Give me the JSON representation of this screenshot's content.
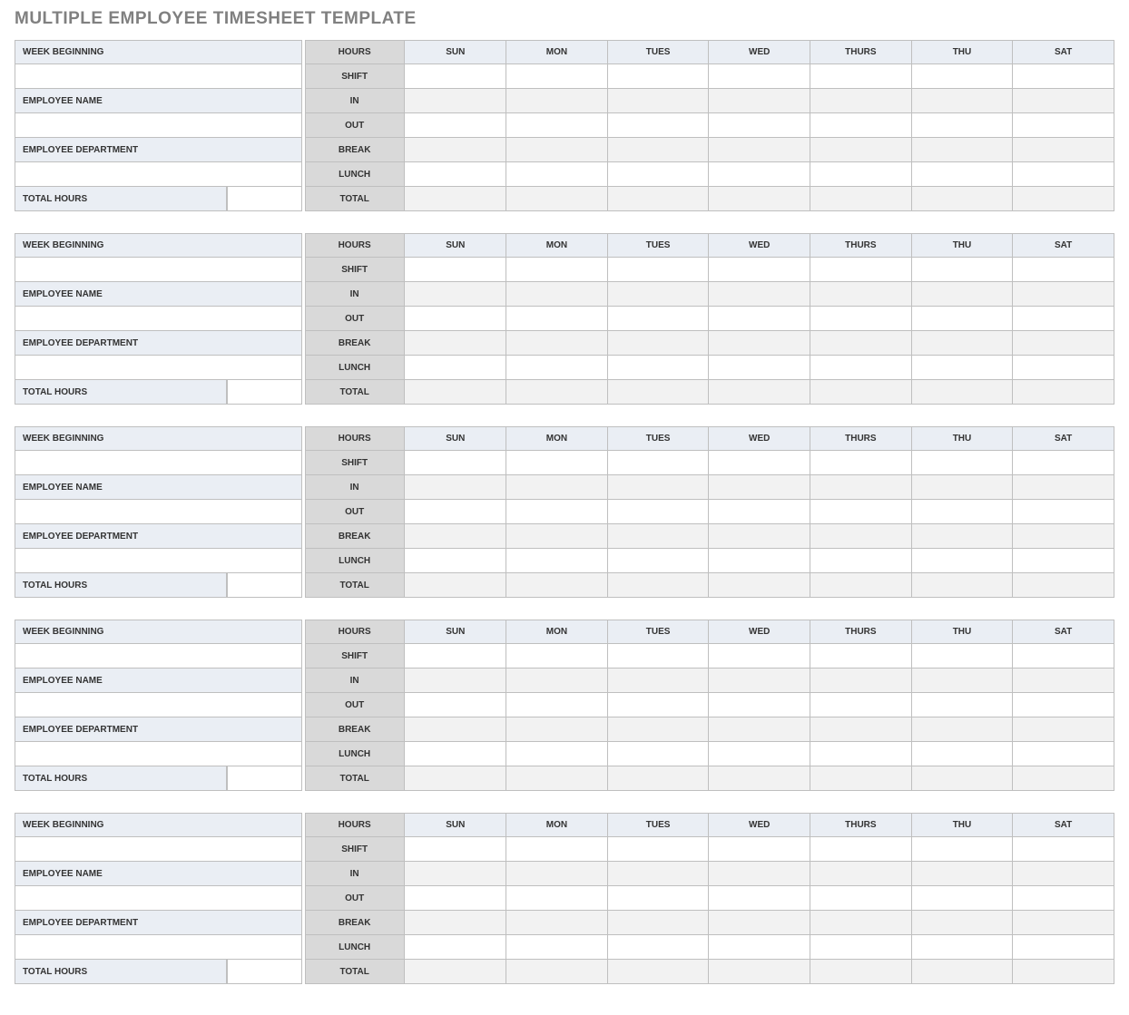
{
  "title": "MULTIPLE EMPLOYEE TIMESHEET TEMPLATE",
  "left_labels": {
    "week_beginning": "WEEK BEGINNING",
    "employee_name": "EMPLOYEE NAME",
    "employee_department": "EMPLOYEE DEPARTMENT",
    "total_hours": "TOTAL HOURS"
  },
  "hours_column": {
    "header": "HOURS",
    "rows": [
      "SHIFT",
      "IN",
      "OUT",
      "BREAK",
      "LUNCH",
      "TOTAL"
    ]
  },
  "days": [
    "SUN",
    "MON",
    "TUES",
    "WED",
    "THURS",
    "THU",
    "SAT"
  ],
  "blocks": [
    {
      "week_beginning": "",
      "employee_name": "",
      "employee_department": "",
      "total_hours": "",
      "cells": {
        "shift": [
          "",
          "",
          "",
          "",
          "",
          "",
          ""
        ],
        "in": [
          "",
          "",
          "",
          "",
          "",
          "",
          ""
        ],
        "out": [
          "",
          "",
          "",
          "",
          "",
          "",
          ""
        ],
        "break": [
          "",
          "",
          "",
          "",
          "",
          "",
          ""
        ],
        "lunch": [
          "",
          "",
          "",
          "",
          "",
          "",
          ""
        ],
        "total": [
          "",
          "",
          "",
          "",
          "",
          "",
          ""
        ]
      }
    },
    {
      "week_beginning": "",
      "employee_name": "",
      "employee_department": "",
      "total_hours": "",
      "cells": {
        "shift": [
          "",
          "",
          "",
          "",
          "",
          "",
          ""
        ],
        "in": [
          "",
          "",
          "",
          "",
          "",
          "",
          ""
        ],
        "out": [
          "",
          "",
          "",
          "",
          "",
          "",
          ""
        ],
        "break": [
          "",
          "",
          "",
          "",
          "",
          "",
          ""
        ],
        "lunch": [
          "",
          "",
          "",
          "",
          "",
          "",
          ""
        ],
        "total": [
          "",
          "",
          "",
          "",
          "",
          "",
          ""
        ]
      }
    },
    {
      "week_beginning": "",
      "employee_name": "",
      "employee_department": "",
      "total_hours": "",
      "cells": {
        "shift": [
          "",
          "",
          "",
          "",
          "",
          "",
          ""
        ],
        "in": [
          "",
          "",
          "",
          "",
          "",
          "",
          ""
        ],
        "out": [
          "",
          "",
          "",
          "",
          "",
          "",
          ""
        ],
        "break": [
          "",
          "",
          "",
          "",
          "",
          "",
          ""
        ],
        "lunch": [
          "",
          "",
          "",
          "",
          "",
          "",
          ""
        ],
        "total": [
          "",
          "",
          "",
          "",
          "",
          "",
          ""
        ]
      }
    },
    {
      "week_beginning": "",
      "employee_name": "",
      "employee_department": "",
      "total_hours": "",
      "cells": {
        "shift": [
          "",
          "",
          "",
          "",
          "",
          "",
          ""
        ],
        "in": [
          "",
          "",
          "",
          "",
          "",
          "",
          ""
        ],
        "out": [
          "",
          "",
          "",
          "",
          "",
          "",
          ""
        ],
        "break": [
          "",
          "",
          "",
          "",
          "",
          "",
          ""
        ],
        "lunch": [
          "",
          "",
          "",
          "",
          "",
          "",
          ""
        ],
        "total": [
          "",
          "",
          "",
          "",
          "",
          "",
          ""
        ]
      }
    },
    {
      "week_beginning": "",
      "employee_name": "",
      "employee_department": "",
      "total_hours": "",
      "cells": {
        "shift": [
          "",
          "",
          "",
          "",
          "",
          "",
          ""
        ],
        "in": [
          "",
          "",
          "",
          "",
          "",
          "",
          ""
        ],
        "out": [
          "",
          "",
          "",
          "",
          "",
          "",
          ""
        ],
        "break": [
          "",
          "",
          "",
          "",
          "",
          "",
          ""
        ],
        "lunch": [
          "",
          "",
          "",
          "",
          "",
          "",
          ""
        ],
        "total": [
          "",
          "",
          "",
          "",
          "",
          "",
          ""
        ]
      }
    }
  ]
}
